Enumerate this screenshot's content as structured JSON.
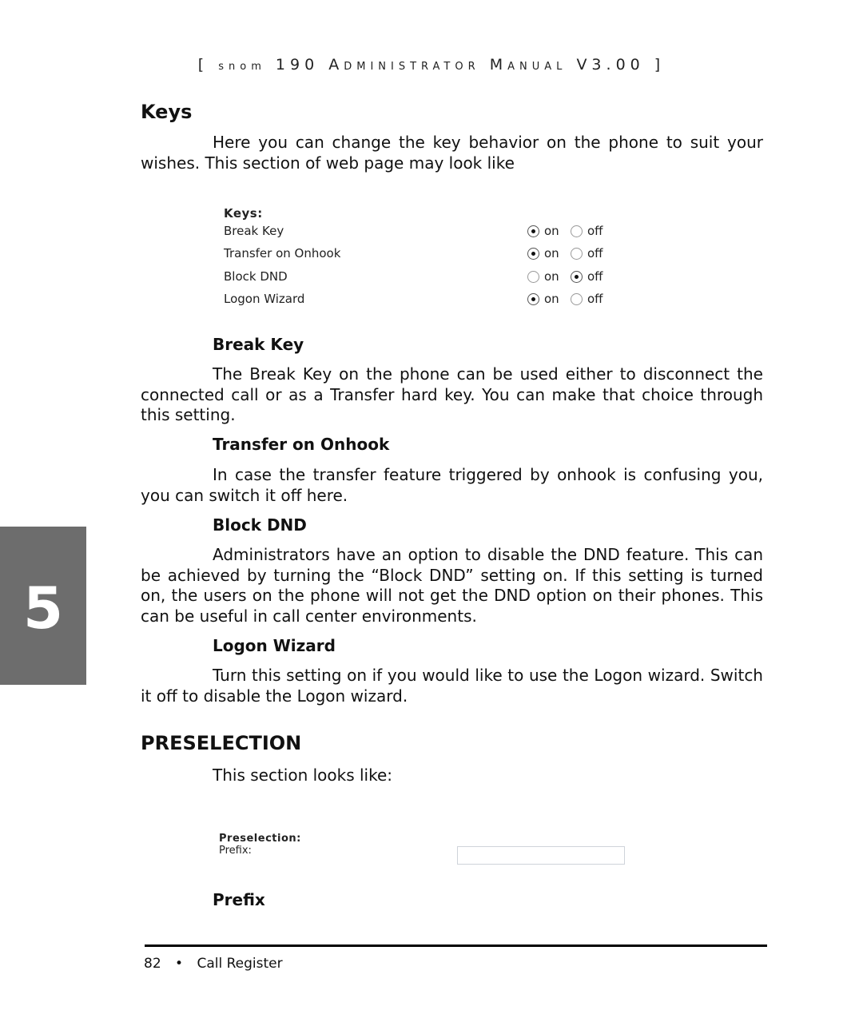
{
  "header": {
    "bracket_open": "[",
    "brand": "snom",
    "model": "190",
    "title_a": "A",
    "title_a_rest": "dministrator",
    "title_m": "M",
    "title_m_rest": "anual",
    "version": "V3.00",
    "bracket_close": "]"
  },
  "chapter_tab": "5",
  "keys_section": {
    "heading": "Keys",
    "intro": "Here you can change the key behavior on the phone to suit your wishes. This section of web page may look like",
    "screenshot": {
      "title": "Keys:",
      "on_label": "on",
      "off_label": "off",
      "rows": [
        {
          "label": "Break Key",
          "value": "on"
        },
        {
          "label": "Transfer on Onhook",
          "value": "on"
        },
        {
          "label": "Block DND",
          "value": "off"
        },
        {
          "label": "Logon Wizard",
          "value": "on"
        }
      ]
    },
    "subsections": [
      {
        "heading": "Break Key",
        "text": "The Break Key on the phone can be used either to disconnect the connected call or as a Transfer hard key. You can make that choice through this setting."
      },
      {
        "heading": "Transfer on Onhook",
        "text": "In case the transfer feature triggered by onhook is confusing you, you can switch it off here."
      },
      {
        "heading": "Block DND",
        "text": "Administrators have an option to disable the DND feature. This can be achieved by turning the “Block DND” setting on. If this setting is turned on, the users on the phone will not get the DND option on their phones. This can be useful in call center environments."
      },
      {
        "heading": "Logon Wizard",
        "text": "Turn this setting on if you would like to use the Logon wizard. Switch it off to disable the Logon wizard."
      }
    ]
  },
  "preselection_section": {
    "heading": "PRESELECTION",
    "intro": "This section looks like:",
    "screenshot": {
      "title": "Preselection:",
      "prefix_label": "Prefix:",
      "prefix_value": ""
    },
    "subheading": "Prefix"
  },
  "footer": {
    "page_number": "82",
    "bullet": "•",
    "section": "Call Register"
  }
}
